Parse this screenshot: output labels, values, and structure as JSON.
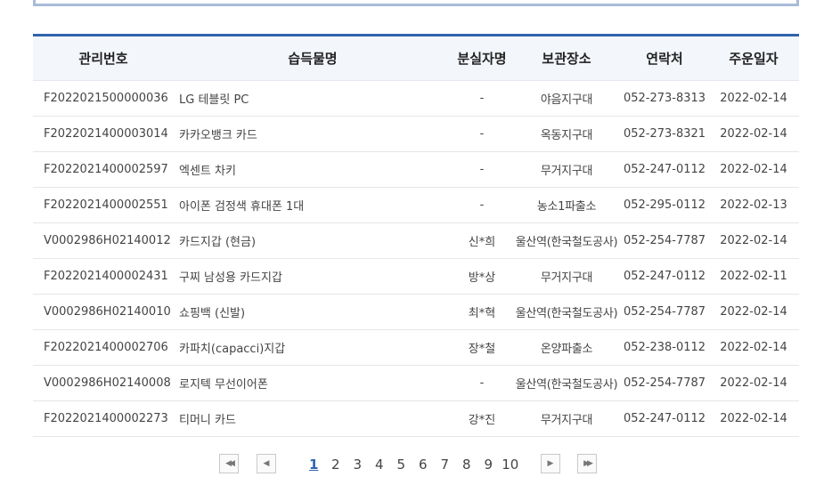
{
  "table": {
    "headers": [
      "관리번호",
      "습득물명",
      "분실자명",
      "보관장소",
      "연락처",
      "주운일자"
    ],
    "rows": [
      [
        "F2022021500000036",
        "LG 테블릿 PC",
        "-",
        "야음지구대",
        "052-273-8313",
        "2022-02-14"
      ],
      [
        "F2022021400003014",
        "카카오뱅크 카드",
        "-",
        "옥동지구대",
        "052-273-8321",
        "2022-02-14"
      ],
      [
        "F2022021400002597",
        "엑센트 차키",
        "-",
        "무거지구대",
        "052-247-0112",
        "2022-02-14"
      ],
      [
        "F2022021400002551",
        "아이폰 검정색 휴대폰 1대",
        "-",
        "농소1파출소",
        "052-295-0112",
        "2022-02-13"
      ],
      [
        "V0002986H02140012",
        "카드지갑 (현금)",
        "신*희",
        "울산역(한국철도공사)",
        "052-254-7787",
        "2022-02-14"
      ],
      [
        "F2022021400002431",
        "구찌 남성용 카드지갑",
        "방*상",
        "무거지구대",
        "052-247-0112",
        "2022-02-11"
      ],
      [
        "V0002986H02140010",
        "쇼핑백 (신발)",
        "최*혁",
        "울산역(한국철도공사)",
        "052-254-7787",
        "2022-02-14"
      ],
      [
        "F2022021400002706",
        "카파치(capacci)지갑",
        "장*철",
        "온양파출소",
        "052-238-0112",
        "2022-02-14"
      ],
      [
        "V0002986H02140008",
        "로지텍 무선이어폰",
        "-",
        "울산역(한국철도공사)",
        "052-254-7787",
        "2022-02-14"
      ],
      [
        "F2022021400002273",
        "티머니 카드",
        "강*진",
        "무거지구대",
        "052-247-0112",
        "2022-02-14"
      ]
    ]
  },
  "pagination": {
    "pages": [
      "1",
      "2",
      "3",
      "4",
      "5",
      "6",
      "7",
      "8",
      "9",
      "10"
    ],
    "current": "1",
    "first_glyph": "◀◀",
    "prev_glyph": "◀",
    "next_glyph": "▶",
    "last_glyph": "▶▶"
  },
  "colors": {
    "accent": "#2f64ad",
    "header_bg": "#f3f6fb",
    "search_box_border": "#a9bcd8"
  }
}
